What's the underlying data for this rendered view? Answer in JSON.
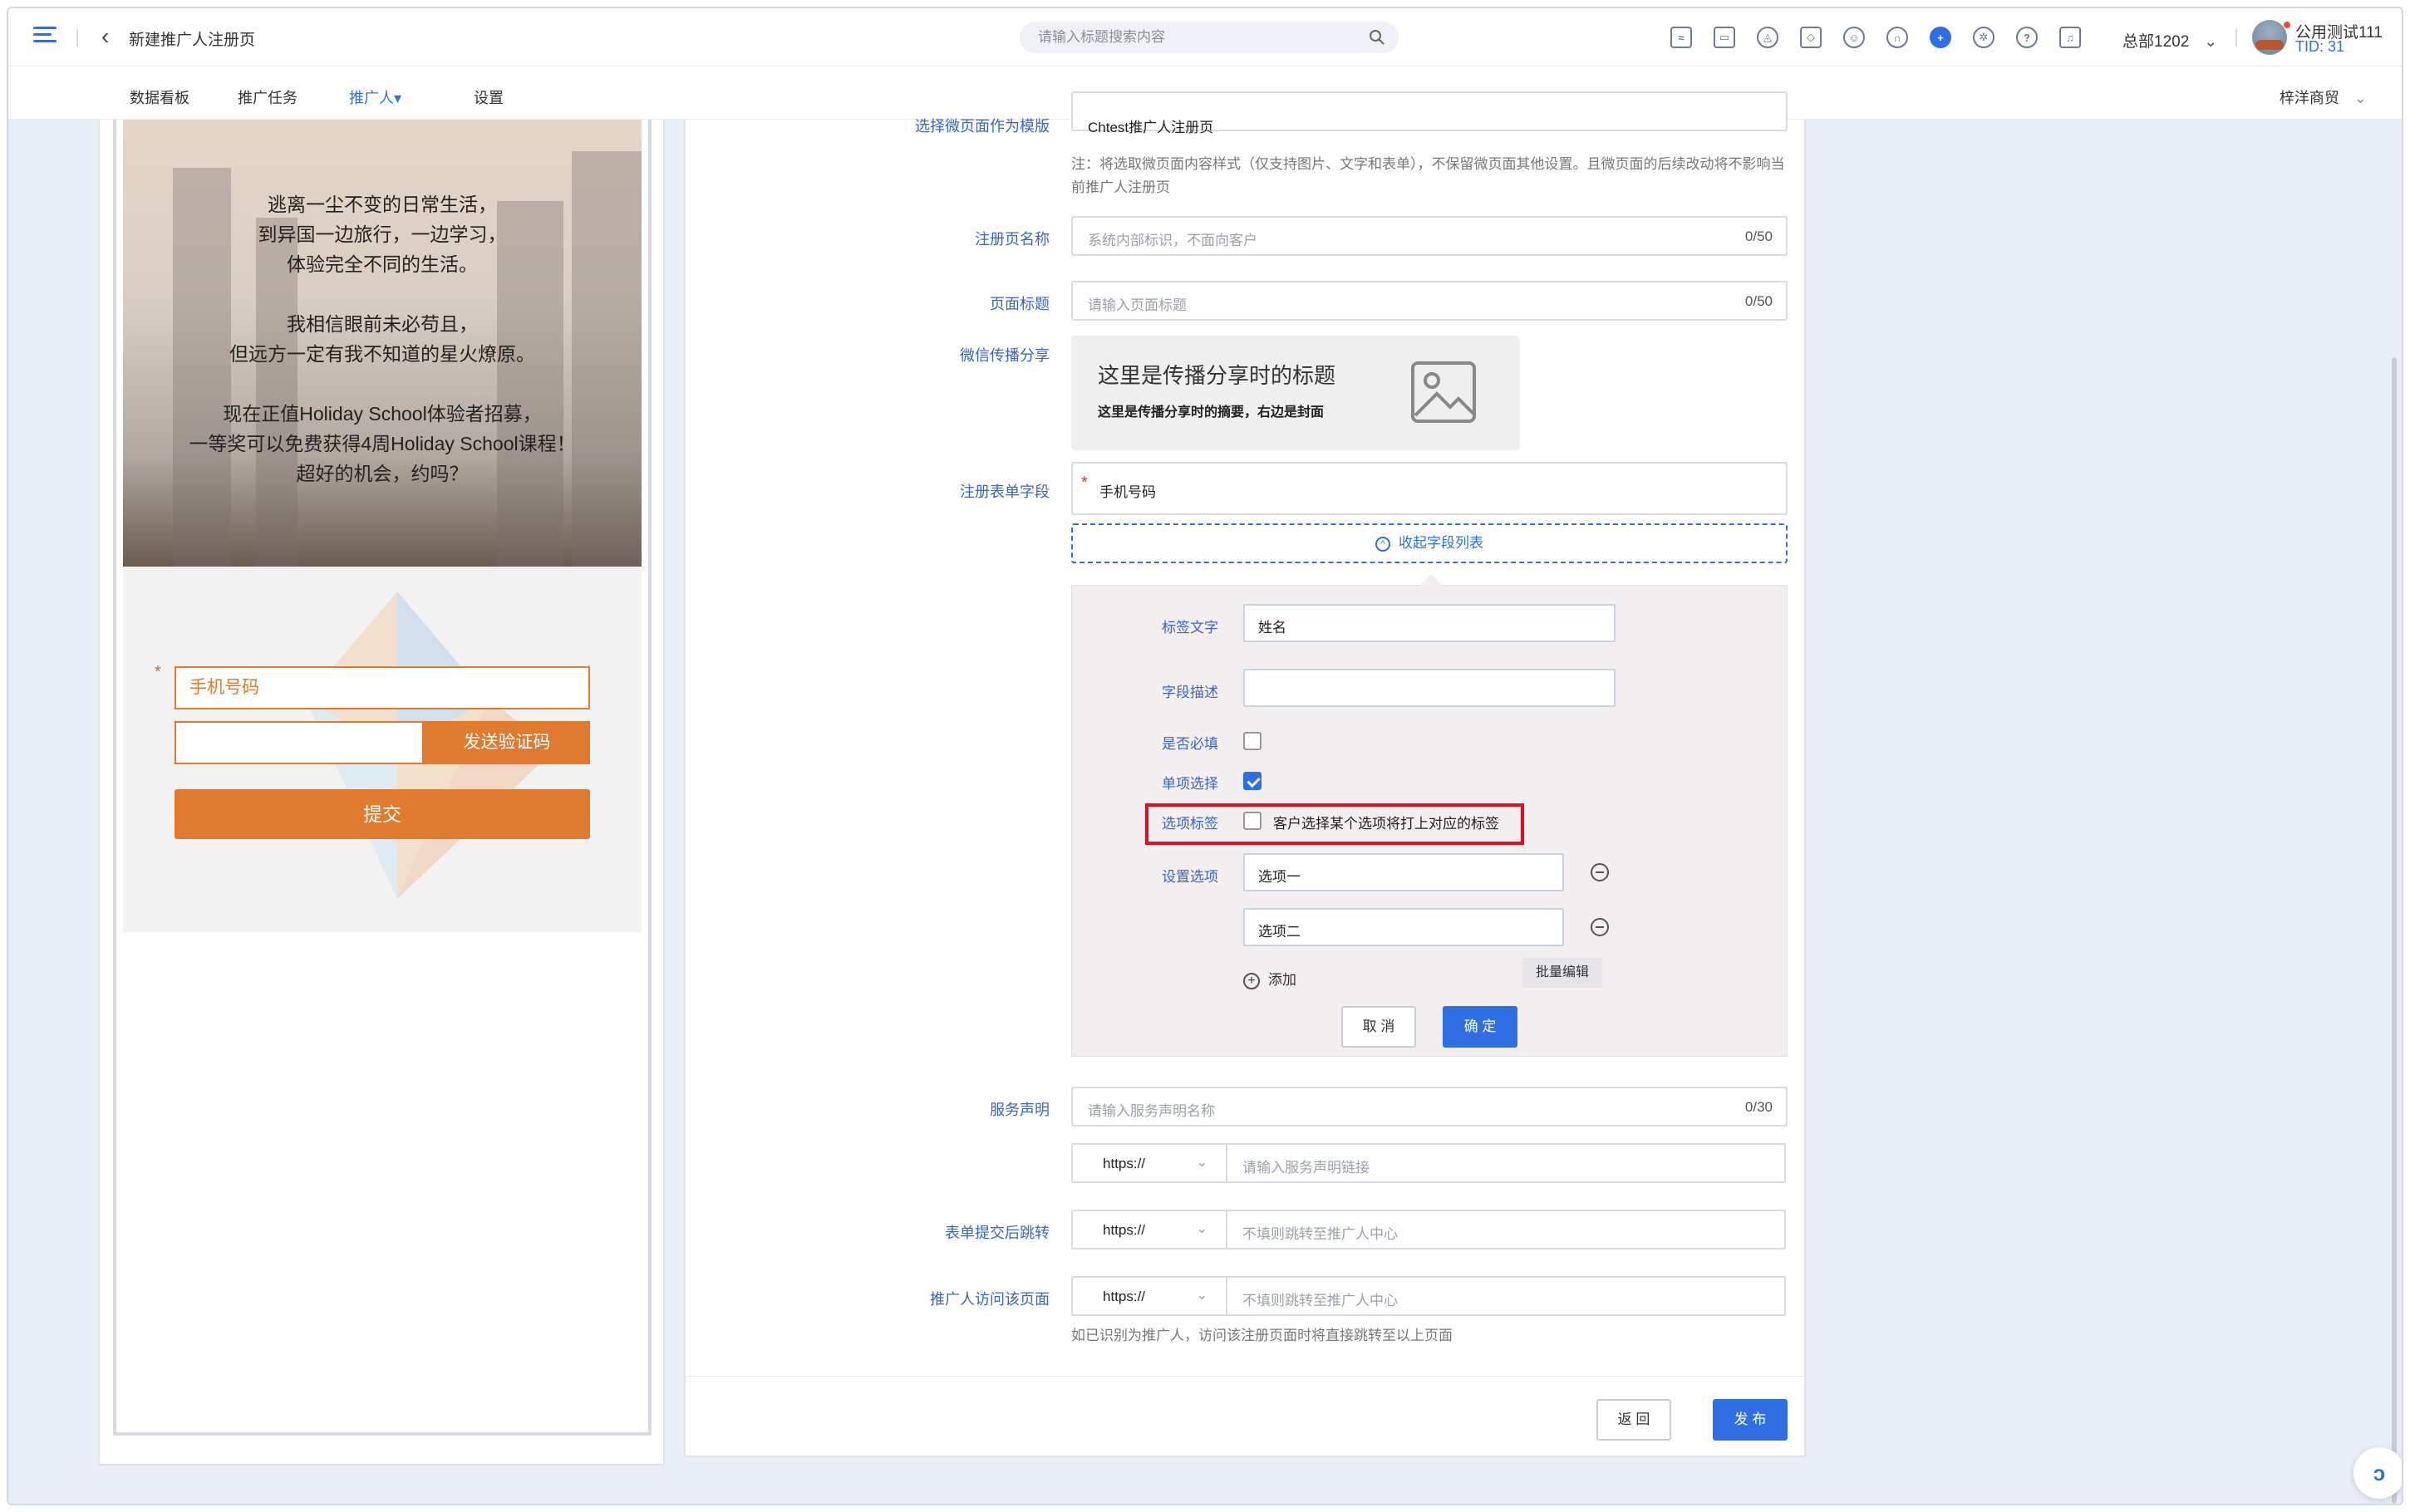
{
  "header": {
    "page_title": "新建推广人注册页",
    "search_placeholder": "请输入标题搜索内容",
    "org_name": "总部1202",
    "user_name": "公用测试111",
    "user_tid": "TID: 31"
  },
  "nav": {
    "items": [
      {
        "label": "数据看板"
      },
      {
        "label": "推广任务"
      },
      {
        "label": "推广人▾"
      },
      {
        "label": "设置"
      }
    ],
    "company": "梓洋商贸"
  },
  "preview": {
    "hero_paragraphs": [
      "逃离一尘不变的日常生活，到异国一边旅行，一边学习，体验完全不同的生活。",
      "我相信眼前未必苟且，但远方一定有我不知道的星火燎原。",
      "现在正值Holiday School体验者招募，一等奖可以免费获得4周Holiday School课程！超好的机会，约吗？"
    ],
    "hero_lines": [
      [
        "逃离一尘不变的日常生活，",
        "到异国一边旅行，一边学习，",
        "体验完全不同的生活。"
      ],
      [
        "我相信眼前未必苟且，",
        "但远方一定有我不知道的星火燎原。"
      ],
      [
        "现在正值Holiday School体验者招募，",
        "一等奖可以免费获得4周Holiday School课程！",
        "超好的机会，约吗？"
      ]
    ],
    "phone_label": "手机号码",
    "send_code_label": "发送验证码",
    "submit_label": "提交"
  },
  "form": {
    "template_label": "选择微页面作为模版",
    "template_value": "Chtest推广人注册页",
    "template_note": "注：将选取微页面内容样式（仅支持图片、文字和表单），不保留微页面其他设置。且微页面的后续改动将不影响当前推广人注册页",
    "name_label": "注册页名称",
    "name_placeholder": "系统内部标识，不面向客户",
    "name_count": "0/50",
    "title_label": "页面标题",
    "title_placeholder": "请输入页面标题",
    "title_count": "0/50",
    "share_label": "微信传播分享",
    "share_title": "这里是传播分享时的标题",
    "share_desc": "这里是传播分享时的摘要，右边是封面",
    "fields_label": "注册表单字段",
    "field_phone": "手机号码",
    "collapse_label": "收起字段列表",
    "editor": {
      "tag_text_label": "标签文字",
      "tag_text_value": "姓名",
      "desc_label": "字段描述",
      "desc_value": "",
      "required_label": "是否必填",
      "required_checked": false,
      "single_label": "单项选择",
      "single_checked": true,
      "option_tag_label": "选项标签",
      "option_tag_text": "客户选择某个选项将打上对应的标签",
      "option_tag_checked": false,
      "options_label": "设置选项",
      "options": [
        "选项一",
        "选项二"
      ],
      "add_label": "添加",
      "batch_label": "批量编辑",
      "cancel_label": "取 消",
      "ok_label": "确 定"
    },
    "service_label": "服务声明",
    "service_placeholder": "请输入服务声明名称",
    "service_count": "0/30",
    "service_link_placeholder": "请输入服务声明链接",
    "redirect_label": "表单提交后跳转",
    "redirect_placeholder": "不填则跳转至推广人中心",
    "visit_label": "推广人访问该页面",
    "visit_placeholder": "不填则跳转至推广人中心",
    "visit_note": "如已识别为推广人，访问该注册页面时将直接跳转至以上页面",
    "protocol": "https://",
    "back_label": "返 回",
    "publish_label": "发 布"
  },
  "colors": {
    "accent": "#2f6fe4",
    "brand_orange": "#e07a2f",
    "highlight_red": "#e0101e"
  }
}
